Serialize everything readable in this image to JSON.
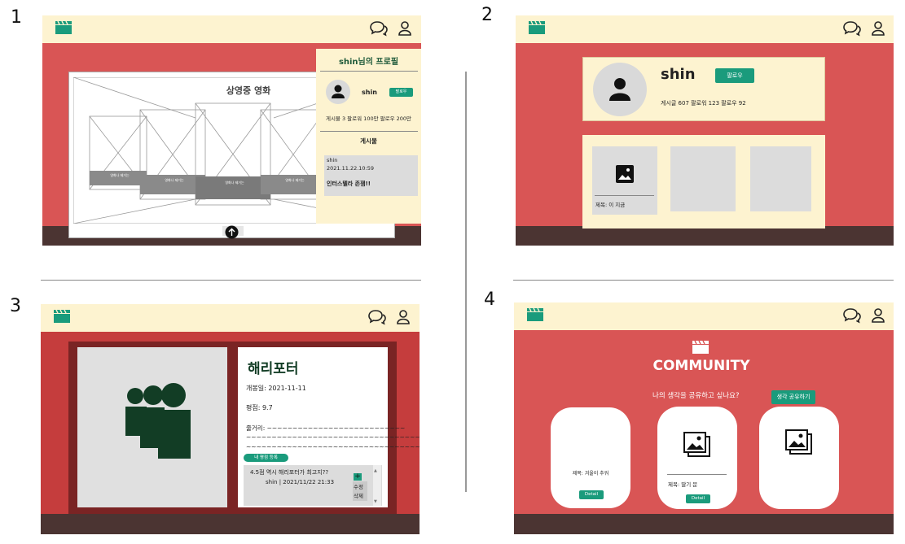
{
  "labels": {
    "p1": "1",
    "p2": "2",
    "p3": "3",
    "p4": "4"
  },
  "panel1": {
    "movies_title": "상영중 영화",
    "movie_label": "영화나 제거는",
    "profile_title": "shin님의 프로필",
    "username": "shin",
    "follow_btn": "팔로우",
    "stats": "게시물 3  팔로워 100만 팔로우 200만",
    "posts_title": "게시물",
    "post": {
      "user": "shin",
      "date": "2021.11.22.10:59",
      "text": "인터스텔라 존잼!!"
    }
  },
  "panel2": {
    "username": "shin",
    "follow_btn": "팔로우",
    "stats": "게시글 607  팔로워 123  팔로우 92",
    "post_caption": "제목: 이 지금"
  },
  "panel3": {
    "movie_title": "해리포터",
    "release": "개봉일: 2021-11-11",
    "rating": "평점: 9.7",
    "plot_label": "줄거리: ~~~~~~~~~~~~~~~~~~~~~~~~~~~",
    "plot_line2": "~~~~~~~~~~~~~~~~~~~~~~~~~~~~~~~~~~~~",
    "plot_line3": "~~~~~~~~~~~~~~~~~~~~~~~~~~~~~~~~~~~~",
    "review_btn": "내 평점 등록",
    "review_text": "4.5점 역시 해리포터가 최고지??",
    "review_meta": "shin | 2021/11/22 21:33",
    "edit": "수정",
    "delete": "삭제",
    "plus": "+"
  },
  "panel4": {
    "heading": "COMMUNITY",
    "question": "나의 생각을 공유하고 싶나요?",
    "share_btn": "생각 공유하기",
    "card1_title": "제목: 겨울이 추워",
    "card2_title": "제목: 딸기 문",
    "detail_btn": "Detail"
  },
  "colors": {
    "red": "#d95555",
    "cream": "#fdf3d0",
    "green": "#1a9b7c",
    "dark_green": "#123d25",
    "footer": "#4b3432"
  }
}
